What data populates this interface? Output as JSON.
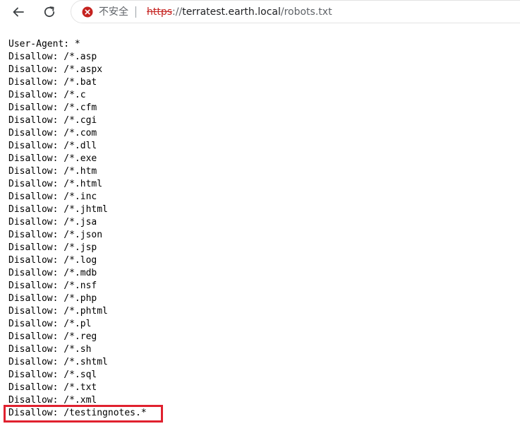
{
  "toolbar": {
    "back_icon": "back-arrow-icon",
    "reload_icon": "reload-icon"
  },
  "omnibox": {
    "security_icon": "not-secure-icon",
    "security_label": "不安全",
    "url_scheme": "https",
    "url_separator": "://",
    "url_host": "terratest.earth.local",
    "url_path": "/robots.txt"
  },
  "colors": {
    "not_secure_red": "#c5221f",
    "highlight_red": "#e0212f"
  },
  "robots_txt": {
    "lines": [
      "User-Agent: *",
      "Disallow: /*.asp",
      "Disallow: /*.aspx",
      "Disallow: /*.bat",
      "Disallow: /*.c",
      "Disallow: /*.cfm",
      "Disallow: /*.cgi",
      "Disallow: /*.com",
      "Disallow: /*.dll",
      "Disallow: /*.exe",
      "Disallow: /*.htm",
      "Disallow: /*.html",
      "Disallow: /*.inc",
      "Disallow: /*.jhtml",
      "Disallow: /*.jsa",
      "Disallow: /*.json",
      "Disallow: /*.jsp",
      "Disallow: /*.log",
      "Disallow: /*.mdb",
      "Disallow: /*.nsf",
      "Disallow: /*.php",
      "Disallow: /*.phtml",
      "Disallow: /*.pl",
      "Disallow: /*.reg",
      "Disallow: /*.sh",
      "Disallow: /*.shtml",
      "Disallow: /*.sql",
      "Disallow: /*.txt",
      "Disallow: /*.xml",
      "Disallow: /testingnotes.*"
    ]
  }
}
